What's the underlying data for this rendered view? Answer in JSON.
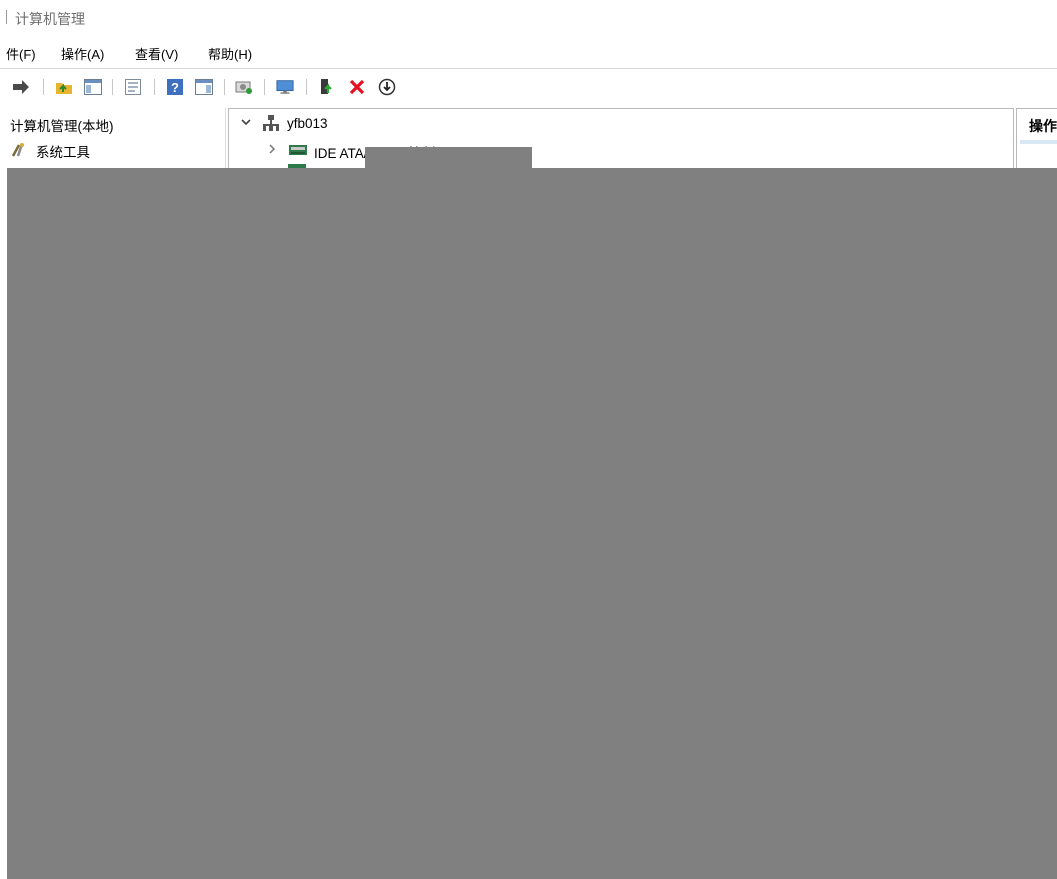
{
  "window": {
    "title": "计算机管理"
  },
  "menu": {
    "items": [
      "件(F)",
      "操作(A)",
      "查看(V)",
      "帮助(H)"
    ]
  },
  "toolbar": {
    "icons": [
      "forward-arrow-icon",
      "up-folder-icon",
      "show-hide-console-tree-icon",
      "properties-icon",
      "help-icon",
      "show-hide-action-pane-icon",
      "scan-hardware-icon",
      "monitor-icon",
      "update-driver-icon",
      "uninstall-icon",
      "disable-device-icon"
    ]
  },
  "left_tree": {
    "root": "计算机管理(本地)",
    "items": [
      "系统工具"
    ]
  },
  "device_tree": {
    "computer": "yfb013",
    "nodes": [
      "IDE ATA/ATAPI 控制器"
    ]
  },
  "actions_pane": {
    "header": "操作"
  },
  "colors": {
    "overlay": "#808080",
    "delete_red": "#e81123"
  }
}
